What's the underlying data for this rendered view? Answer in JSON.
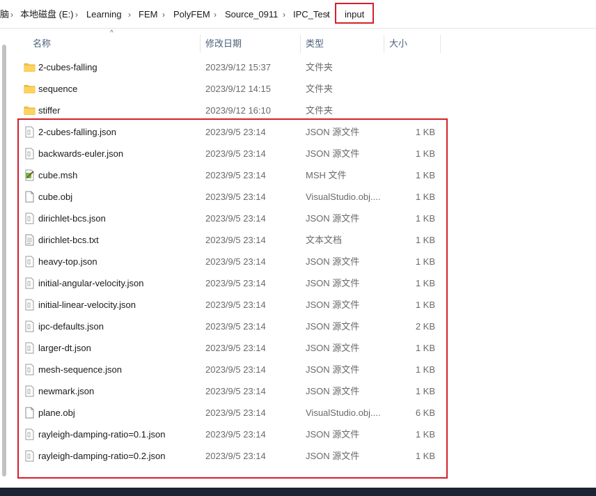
{
  "breadcrumb": {
    "items": [
      "脑",
      "本地磁盘 (E:)",
      "Learning",
      "FEM",
      "PolyFEM",
      "Source_0911",
      "IPC_Test",
      "input"
    ],
    "separator": "›"
  },
  "columns": {
    "name": "名称",
    "modified": "修改日期",
    "type": "类型",
    "size": "大小",
    "sort_indicator": "^"
  },
  "files": [
    {
      "name": "2-cubes-falling",
      "modified": "2023/9/12 15:37",
      "type": "文件夹",
      "size": "",
      "icon": "folder-icon"
    },
    {
      "name": "sequence",
      "modified": "2023/9/12 14:15",
      "type": "文件夹",
      "size": "",
      "icon": "folder-icon"
    },
    {
      "name": "stiffer",
      "modified": "2023/9/12 16:10",
      "type": "文件夹",
      "size": "",
      "icon": "folder-icon"
    },
    {
      "name": "2-cubes-falling.json",
      "modified": "2023/9/5 23:14",
      "type": "JSON 源文件",
      "size": "1 KB",
      "icon": "json-file-icon"
    },
    {
      "name": "backwards-euler.json",
      "modified": "2023/9/5 23:14",
      "type": "JSON 源文件",
      "size": "1 KB",
      "icon": "json-file-icon"
    },
    {
      "name": "cube.msh",
      "modified": "2023/9/5 23:14",
      "type": "MSH 文件",
      "size": "1 KB",
      "icon": "msh-file-icon"
    },
    {
      "name": "cube.obj",
      "modified": "2023/9/5 23:14",
      "type": "VisualStudio.obj....",
      "size": "1 KB",
      "icon": "obj-file-icon"
    },
    {
      "name": "dirichlet-bcs.json",
      "modified": "2023/9/5 23:14",
      "type": "JSON 源文件",
      "size": "1 KB",
      "icon": "json-file-icon"
    },
    {
      "name": "dirichlet-bcs.txt",
      "modified": "2023/9/5 23:14",
      "type": "文本文档",
      "size": "1 KB",
      "icon": "text-file-icon"
    },
    {
      "name": "heavy-top.json",
      "modified": "2023/9/5 23:14",
      "type": "JSON 源文件",
      "size": "1 KB",
      "icon": "json-file-icon"
    },
    {
      "name": "initial-angular-velocity.json",
      "modified": "2023/9/5 23:14",
      "type": "JSON 源文件",
      "size": "1 KB",
      "icon": "json-file-icon"
    },
    {
      "name": "initial-linear-velocity.json",
      "modified": "2023/9/5 23:14",
      "type": "JSON 源文件",
      "size": "1 KB",
      "icon": "json-file-icon"
    },
    {
      "name": "ipc-defaults.json",
      "modified": "2023/9/5 23:14",
      "type": "JSON 源文件",
      "size": "2 KB",
      "icon": "json-file-icon"
    },
    {
      "name": "larger-dt.json",
      "modified": "2023/9/5 23:14",
      "type": "JSON 源文件",
      "size": "1 KB",
      "icon": "json-file-icon"
    },
    {
      "name": "mesh-sequence.json",
      "modified": "2023/9/5 23:14",
      "type": "JSON 源文件",
      "size": "1 KB",
      "icon": "json-file-icon"
    },
    {
      "name": "newmark.json",
      "modified": "2023/9/5 23:14",
      "type": "JSON 源文件",
      "size": "1 KB",
      "icon": "json-file-icon"
    },
    {
      "name": "plane.obj",
      "modified": "2023/9/5 23:14",
      "type": "VisualStudio.obj....",
      "size": "6 KB",
      "icon": "obj-file-icon"
    },
    {
      "name": "rayleigh-damping-ratio=0.1.json",
      "modified": "2023/9/5 23:14",
      "type": "JSON 源文件",
      "size": "1 KB",
      "icon": "json-file-icon"
    },
    {
      "name": "rayleigh-damping-ratio=0.2.json",
      "modified": "2023/9/5 23:14",
      "type": "JSON 源文件",
      "size": "1 KB",
      "icon": "json-file-icon"
    }
  ],
  "colors": {
    "highlight": "#d4202a",
    "folder": "#f5c342",
    "header_text": "#4c607a"
  }
}
